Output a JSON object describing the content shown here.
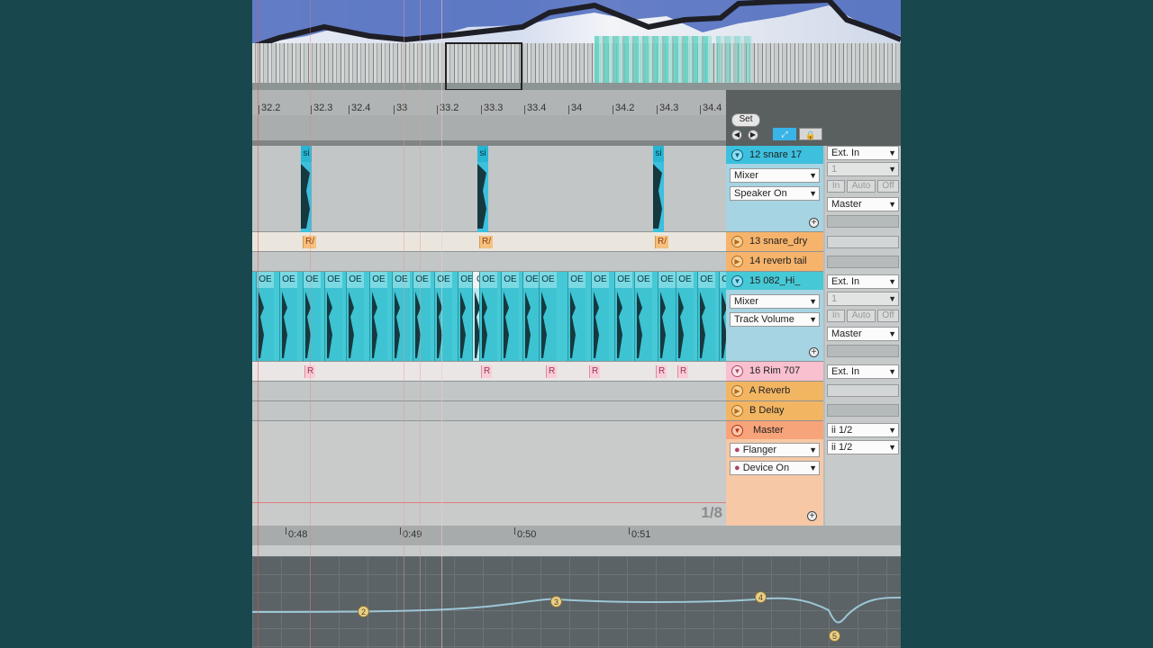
{
  "ruler": {
    "ticks": [
      "32.2",
      "32.3",
      "32.4",
      "33",
      "33.2",
      "33.3",
      "33.4",
      "34",
      "34.2",
      "34.3",
      "34.4"
    ]
  },
  "controls": {
    "set_label": "Set",
    "back_icon": "arrow-left-icon",
    "forward_icon": "arrow-right-icon",
    "follow_icon": "follow-icon",
    "lock_icon": "lock-icon"
  },
  "clips": {
    "snare_label": "si",
    "hihat_label": "OE",
    "hihat_selected_label": "O(",
    "resample_tag": "R/",
    "rim_tag": "R"
  },
  "grid_fraction": "1/8",
  "tracks": [
    {
      "id": "t12",
      "name": "12 snare 17",
      "color": "#3cc0de",
      "input": "Ext. In",
      "channel": "1",
      "monitor": [
        "In",
        "Auto",
        "Off"
      ],
      "output": "Master",
      "device_chooser": "Mixer",
      "param_chooser": "Speaker On"
    },
    {
      "id": "t13",
      "name": "13 snare_dry",
      "color": "#f6b36b"
    },
    {
      "id": "t14",
      "name": "14 reverb tail",
      "color": "#f6b36b"
    },
    {
      "id": "t15",
      "name": "15 082_Hi_",
      "color": "#46c9d6",
      "input": "Ext. In",
      "channel": "1",
      "monitor": [
        "In",
        "Auto",
        "Off"
      ],
      "output": "Master",
      "device_chooser": "Mixer",
      "param_chooser": "Track Volume"
    },
    {
      "id": "t16",
      "name": "16 Rim 707",
      "color": "#f9c0cf",
      "input": "Ext. In"
    },
    {
      "id": "ra",
      "name": "A Reverb",
      "color": "#f2b562"
    },
    {
      "id": "rb",
      "name": "B Delay",
      "color": "#f2b562"
    },
    {
      "id": "master",
      "name": "Master",
      "color": "#f8a47a",
      "output1": "ii 1/2",
      "output2": "ii 1/2",
      "device_chooser": "Flanger",
      "param_chooser": "Device On"
    }
  ],
  "timeline": {
    "times": [
      "0:48",
      "0:49",
      "0:50",
      "0:51"
    ]
  },
  "automation": {
    "breakpoints": [
      "2",
      "3",
      "4",
      "5"
    ]
  }
}
